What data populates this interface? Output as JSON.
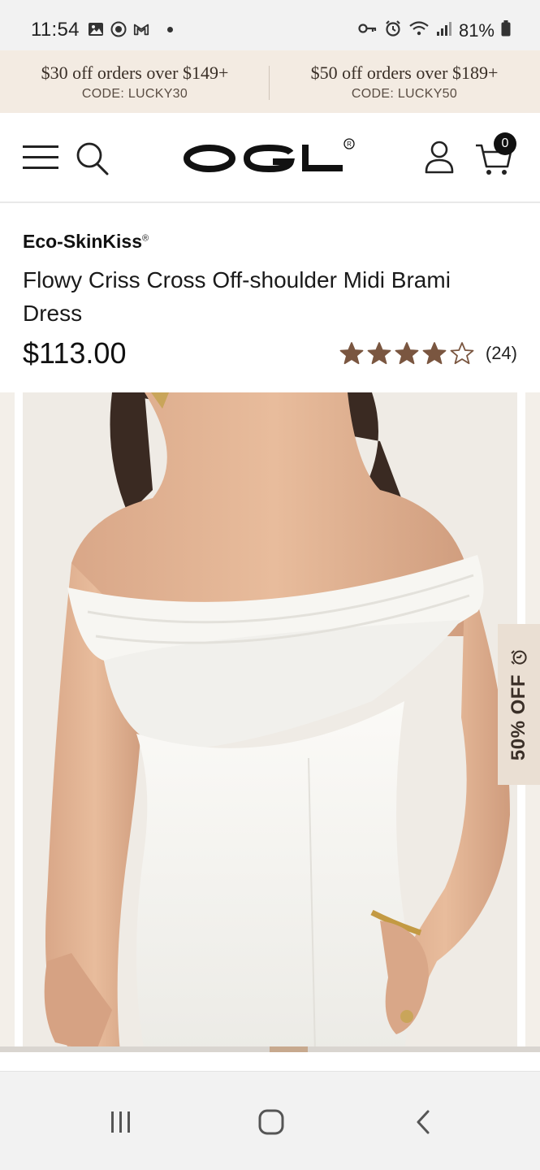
{
  "status_bar": {
    "time": "11:54",
    "battery": "81%",
    "icons_left": [
      "gallery-icon",
      "vpn-icon",
      "gmail-icon",
      "notification-dot"
    ],
    "icons_right": [
      "key-icon",
      "alarm-icon",
      "wifi-icon",
      "signal-icon",
      "battery-icon"
    ]
  },
  "promo": {
    "items": [
      {
        "offer": "$30 off orders over $149+",
        "code": "CODE: LUCKY30"
      },
      {
        "offer": "$50 off orders over $189+",
        "code": "CODE: LUCKY50"
      }
    ]
  },
  "header": {
    "logo": "OGL",
    "cart_count": "0",
    "icons": [
      "menu-icon",
      "search-icon",
      "account-icon",
      "cart-icon"
    ]
  },
  "product": {
    "brand": "Eco-SkinKiss",
    "brand_mark": "®",
    "title": "Flowy Criss Cross Off-shoulder Midi Brami Dress",
    "price": "$113.00",
    "rating": 4,
    "rating_max": 5,
    "review_count": "(24)"
  },
  "gallery": {
    "discount_label": "50% OFF",
    "discount_icon": "alarm-clock-icon",
    "image_subject": "white off-shoulder dress photo",
    "progress": 0.07
  },
  "nav_bar": {
    "buttons": [
      "recents-button",
      "home-button",
      "back-button"
    ]
  },
  "colors": {
    "promo_bg": "#f3ebe2",
    "star": "#7a5640",
    "discount_bg": "#eadfd3",
    "accent": "#c7a98e"
  }
}
